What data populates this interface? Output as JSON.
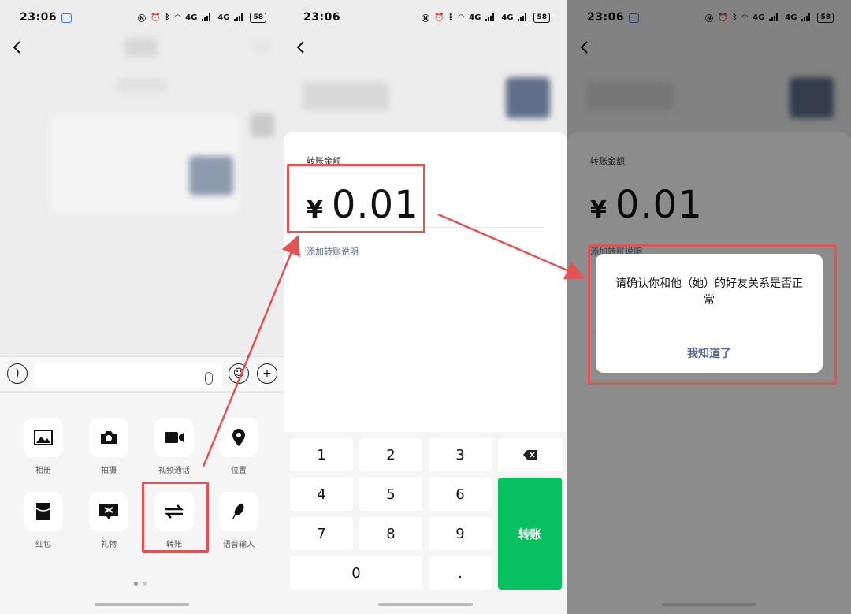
{
  "status_bar": {
    "time": "23:06",
    "network": "4G",
    "battery": "58"
  },
  "panel1": {
    "tools": [
      {
        "label": "相册",
        "icon": "photo-album-icon"
      },
      {
        "label": "拍摄",
        "icon": "camera-icon"
      },
      {
        "label": "视频通话",
        "icon": "video-call-icon"
      },
      {
        "label": "位置",
        "icon": "location-pin-icon"
      },
      {
        "label": "红包",
        "icon": "red-packet-icon"
      },
      {
        "label": "礼物",
        "icon": "gift-icon"
      },
      {
        "label": "转账",
        "icon": "transfer-icon"
      },
      {
        "label": "语音输入",
        "icon": "voice-input-icon"
      }
    ]
  },
  "panel2": {
    "amount_label": "转账金额",
    "currency_symbol": "¥",
    "amount": "0.01",
    "add_note": "添加转账说明",
    "keys": [
      "1",
      "2",
      "3",
      "4",
      "5",
      "6",
      "7",
      "8",
      "9",
      "0",
      "."
    ],
    "transfer_button": "转账"
  },
  "panel3": {
    "amount_label": "转账金额",
    "currency_symbol": "¥",
    "amount": "0.01",
    "add_note_partial": "添加转账说明",
    "dialog_message": "请确认你和他（她）的好友关系是否正常",
    "dialog_button": "我知道了"
  },
  "colors": {
    "highlight": "#e55253",
    "wechat_green": "#07c160",
    "link_blue": "#576b95"
  }
}
